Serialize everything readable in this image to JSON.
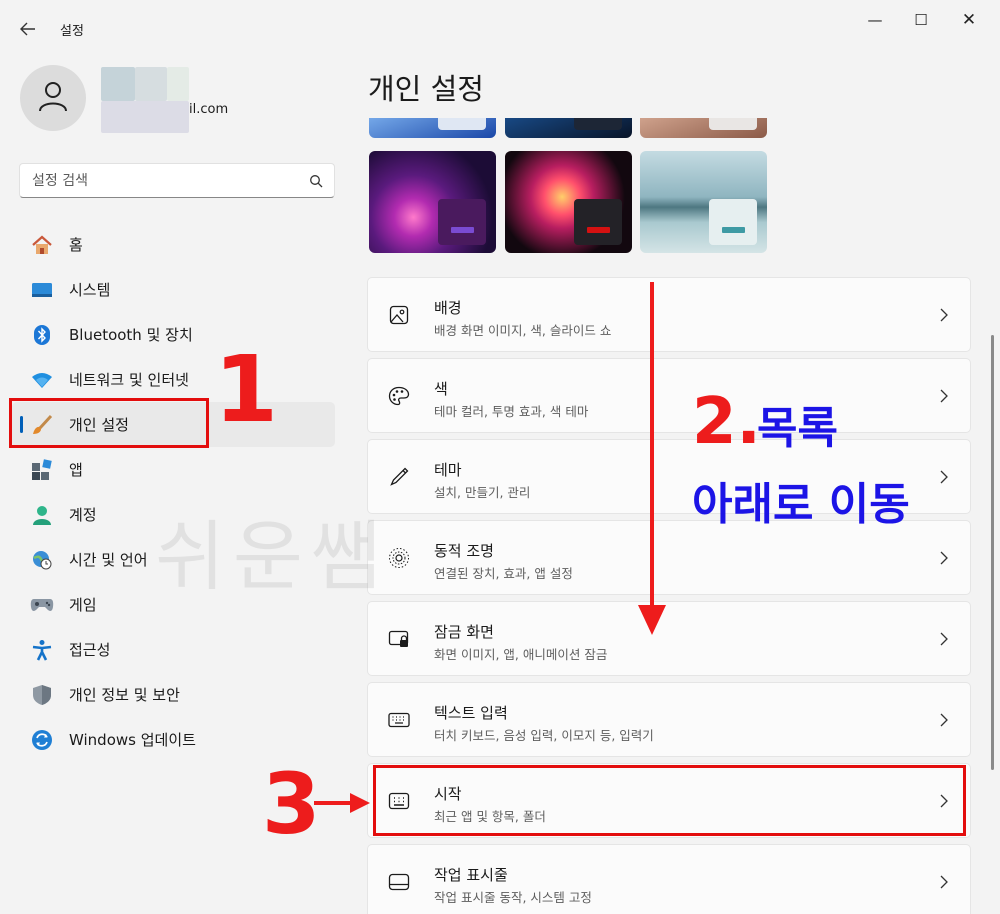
{
  "window": {
    "title": "설정",
    "back_icon": "arrow-left-icon",
    "minimize_glyph": "—",
    "maximize_glyph": "☐",
    "close_glyph": "✕"
  },
  "user": {
    "email_suffix": "il.com"
  },
  "search": {
    "placeholder": "설정 검색"
  },
  "nav": {
    "items": [
      {
        "label": "홈",
        "icon": "home-icon"
      },
      {
        "label": "시스템",
        "icon": "system-icon"
      },
      {
        "label": "Bluetooth 및 장치",
        "icon": "bluetooth-icon"
      },
      {
        "label": "네트워크 및 인터넷",
        "icon": "wifi-icon"
      },
      {
        "label": "개인 설정",
        "icon": "brush-icon",
        "active": true
      },
      {
        "label": "앱",
        "icon": "apps-icon"
      },
      {
        "label": "계정",
        "icon": "account-icon"
      },
      {
        "label": "시간 및 언어",
        "icon": "globe-clock-icon"
      },
      {
        "label": "게임",
        "icon": "gamepad-icon"
      },
      {
        "label": "접근성",
        "icon": "accessibility-icon"
      },
      {
        "label": "개인 정보 및 보안",
        "icon": "shield-icon"
      },
      {
        "label": "Windows 업데이트",
        "icon": "update-icon"
      }
    ]
  },
  "main": {
    "title": "개인 설정",
    "cards": [
      {
        "title": "배경",
        "subtitle": "배경 화면 이미지, 색, 슬라이드 쇼",
        "icon": "image-icon"
      },
      {
        "title": "색",
        "subtitle": "테마 컬러, 투명 효과, 색 테마",
        "icon": "palette-icon"
      },
      {
        "title": "테마",
        "subtitle": "설치, 만들기, 관리",
        "icon": "pen-icon"
      },
      {
        "title": "동적 조명",
        "subtitle": "연결된 장치, 효과, 앱 설정",
        "icon": "lighting-icon"
      },
      {
        "title": "잠금 화면",
        "subtitle": "화면 이미지, 앱, 애니메이션 잠금",
        "icon": "lock-screen-icon"
      },
      {
        "title": "텍스트 입력",
        "subtitle": "터치 키보드, 음성 입력, 이모지 등, 입력기",
        "icon": "keyboard-icon"
      },
      {
        "title": "시작",
        "subtitle": "최근 앱 및 항목, 폴더",
        "icon": "start-icon"
      },
      {
        "title": "작업 표시줄",
        "subtitle": "작업 표시줄 동작, 시스템 고정",
        "icon": "taskbar-icon"
      }
    ]
  },
  "annotations": {
    "step1": "1",
    "step2_num": "2.",
    "step2_line1": "목록",
    "step2_line2": "아래로 이동",
    "step3": "3",
    "watermark": "쉬운쌤"
  },
  "colors": {
    "accent": "#005fb8",
    "annotation_red": "#ed1c1c",
    "annotation_blue": "#1c14e6"
  }
}
